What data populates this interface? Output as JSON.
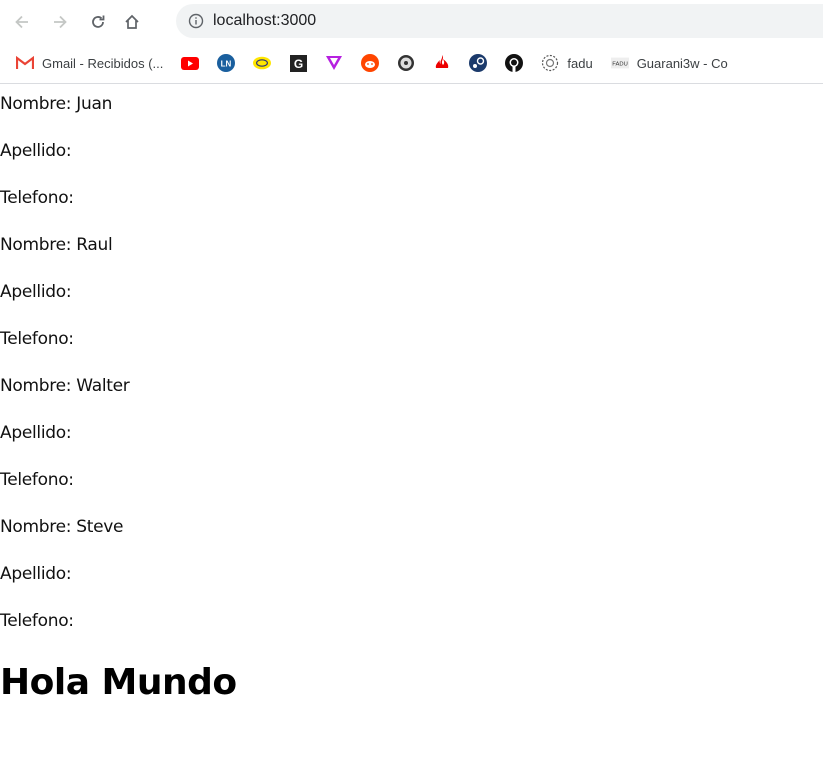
{
  "browser": {
    "url": "localhost:3000",
    "bookmarks": [
      {
        "icon": "gmail-icon",
        "label": "Gmail - Recibidos (..."
      },
      {
        "icon": "youtube-icon",
        "label": ""
      },
      {
        "icon": "ln-icon",
        "label": ""
      },
      {
        "icon": "mercadolibre-icon",
        "label": ""
      },
      {
        "icon": "g-icon",
        "label": ""
      },
      {
        "icon": "triangle-icon",
        "label": ""
      },
      {
        "icon": "reddit-icon",
        "label": ""
      },
      {
        "icon": "wheel-icon",
        "label": ""
      },
      {
        "icon": "santander-icon",
        "label": ""
      },
      {
        "icon": "steam-icon",
        "label": ""
      },
      {
        "icon": "github-icon",
        "label": ""
      },
      {
        "icon": "globe-icon",
        "label": "fadu"
      },
      {
        "icon": "fadu-icon",
        "label": "Guarani3w - Co"
      }
    ]
  },
  "people": [
    {
      "nombre": "Nombre: Juan",
      "apellido": "Apellido:",
      "telefono": "Telefono:"
    },
    {
      "nombre": "Nombre: Raul",
      "apellido": "Apellido:",
      "telefono": "Telefono:"
    },
    {
      "nombre": "Nombre: Walter",
      "apellido": "Apellido:",
      "telefono": "Telefono:"
    },
    {
      "nombre": "Nombre: Steve",
      "apellido": "Apellido:",
      "telefono": "Telefono:"
    }
  ],
  "heading": "Hola Mundo"
}
